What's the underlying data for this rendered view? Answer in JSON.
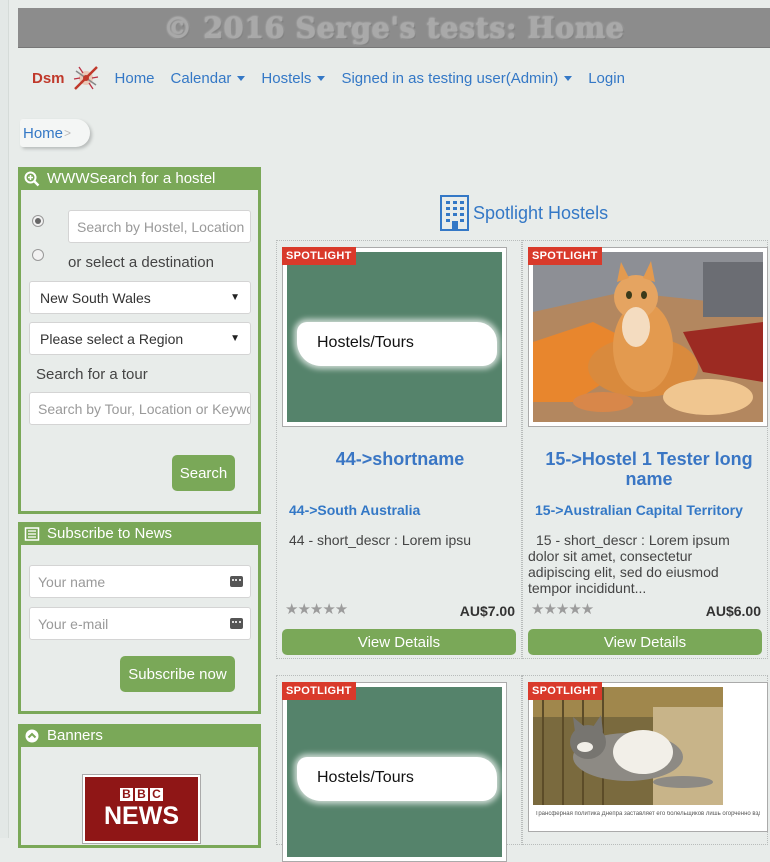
{
  "header": {
    "title": "© 2016 Serge's tests: Home"
  },
  "nav": {
    "brand": "Dsm",
    "items": [
      {
        "label": "Home",
        "dropdown": false
      },
      {
        "label": "Calendar",
        "dropdown": true
      },
      {
        "label": "Hostels",
        "dropdown": true
      },
      {
        "label": "Signed in as testing user(Admin)",
        "dropdown": true
      },
      {
        "label": "Login",
        "dropdown": false
      }
    ]
  },
  "breadcrumb": {
    "home": "Home",
    "separator": ">"
  },
  "search_panel": {
    "title": "WWWSearch for a hostel",
    "search_placeholder": "Search by Hostel, Location",
    "or_select": "or select a destination",
    "state_value": "New South Wales",
    "region_value": "Please select a Region",
    "tour_label": "Search for a tour",
    "tour_placeholder": "Search by Tour, Location or Keyword",
    "search_button": "Search"
  },
  "news_panel": {
    "title": "Subscribe to News",
    "name_placeholder": "Your name",
    "email_placeholder": "Your e-mail",
    "button": "Subscribe now"
  },
  "banner_panel": {
    "title": "Banners",
    "bbc_letters": [
      "B",
      "B",
      "C"
    ],
    "bbc_news": "NEWS"
  },
  "spotlight": {
    "title": "Spotlight Hostels",
    "ribbon": "SPOTLIGHT",
    "image_caption": "Hostels/Tours",
    "cards": [
      {
        "name": "44->shortname",
        "region": "44->South Australia",
        "desc": "44 - short_descr : Lorem ipsu",
        "price": "AU$7.00",
        "rating": 0,
        "button": "View Details"
      },
      {
        "name": "15->Hostel 1 Tester long name",
        "region": "15->Australian Capital Territory",
        "desc": "15 - short_descr : Lorem ipsum dolor sit amet, consectetur adipiscing elit, sed do eiusmod tempor incididunt...",
        "price": "AU$6.00",
        "rating": 0,
        "button": "View Details"
      }
    ],
    "stars_symbol": "★★★★★",
    "caption_small": "Трансферная политика Днепра заставляет его болельщиков лишь огорченно вздыхать"
  },
  "colors": {
    "accent_green": "#7aa858",
    "link_blue": "#3478c6",
    "ribbon_red": "#d93a2b"
  }
}
